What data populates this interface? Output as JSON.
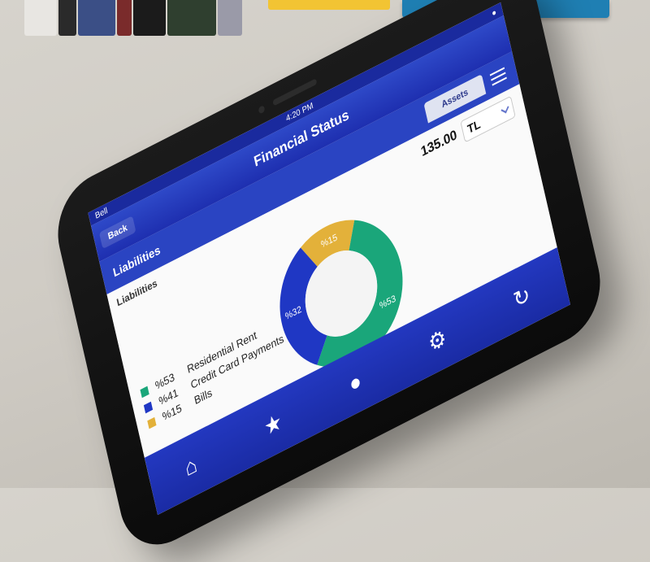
{
  "status_bar": {
    "carrier": "Bell",
    "time": "4:20 PM"
  },
  "nav": {
    "back_label": "Back",
    "title": "Financial Status"
  },
  "tabs": [
    {
      "label": "Assets",
      "selected": false
    },
    {
      "label": "Liabilities",
      "selected": true
    }
  ],
  "sub_header": {
    "title": "Liabilities",
    "menu_icon": "list-icon"
  },
  "content": {
    "section_label": "Liabilities",
    "amount": "135.00",
    "currency": "TL"
  },
  "colors": {
    "green": "#1aa67a",
    "blue": "#1f37c4",
    "yellow": "#e3b13a",
    "bar_blue": "#2138bf"
  },
  "chart_data": {
    "type": "pie",
    "slices": [
      {
        "label": "%53",
        "value": 53,
        "color": "#1aa67a"
      },
      {
        "label": "%32",
        "value": 32,
        "color": "#1f37c4"
      },
      {
        "label": "%15",
        "value": 15,
        "color": "#e3b13a"
      }
    ],
    "legend": [
      {
        "pct": "%53",
        "name": "Residential Rent",
        "color": "#1aa67a"
      },
      {
        "pct": "%41",
        "name": "Credit Card Payments",
        "color": "#1f37c4"
      },
      {
        "pct": "%15",
        "name": "Bills",
        "color": "#e3b13a"
      }
    ]
  },
  "bottom_tabs": [
    "home-icon",
    "star-icon",
    "profile-icon",
    "gear-icon",
    "refresh-icon"
  ]
}
